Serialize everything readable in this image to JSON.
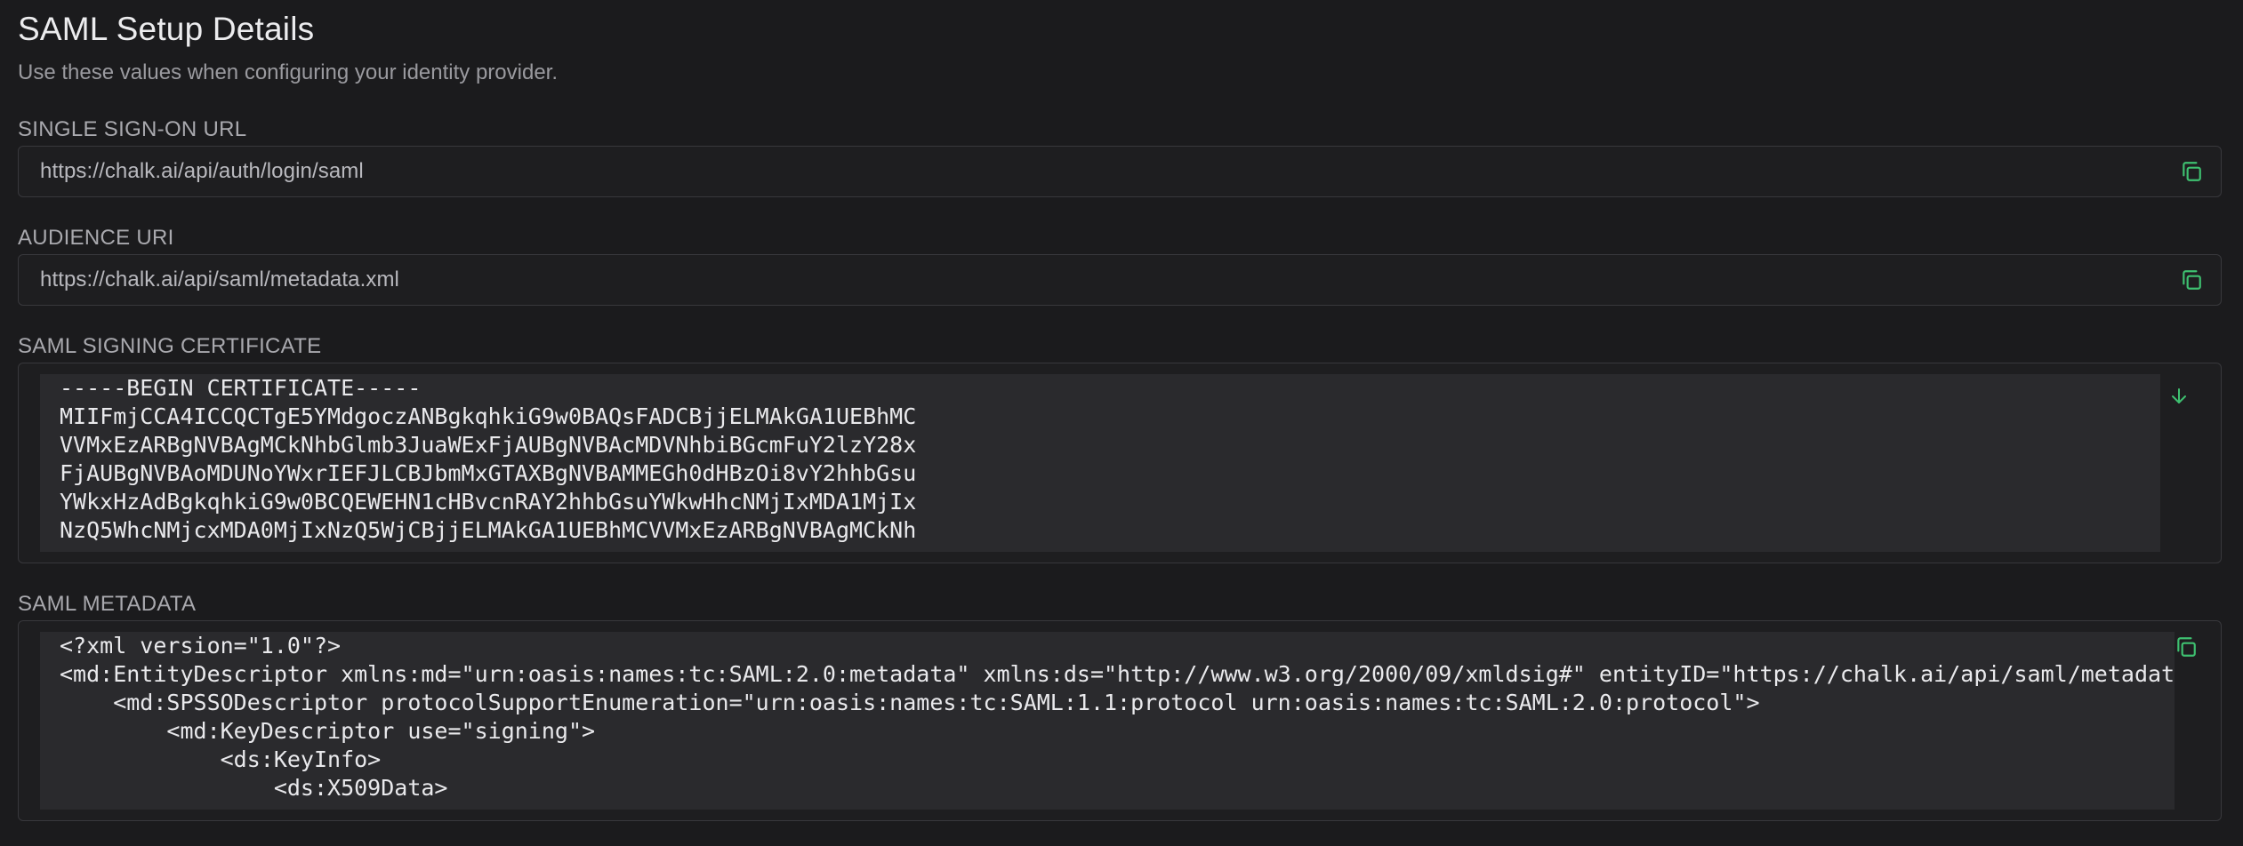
{
  "header": {
    "title": "SAML Setup Details",
    "subtitle": "Use these values when configuring your identity provider."
  },
  "sso": {
    "label": "SINGLE SIGN-ON URL",
    "value": "https://chalk.ai/api/auth/login/saml",
    "action_icon": "copy-icon"
  },
  "audience": {
    "label": "AUDIENCE URI",
    "value": "https://chalk.ai/api/saml/metadata.xml",
    "action_icon": "copy-icon"
  },
  "certificate": {
    "label": "SAML SIGNING CERTIFICATE",
    "action_icon": "download-icon",
    "content": "-----BEGIN CERTIFICATE-----\nMIIFmjCCA4ICCQCTgE5YMdgoczANBgkqhkiG9w0BAQsFADCBjjELMAkGA1UEBhMC\nVVMxEzARBgNVBAgMCkNhbGlmb3JuaWExFjAUBgNVBAcMDVNhbiBGcmFuY2lzY28x\nFjAUBgNVBAoMDUNoYWxrIEFJLCBJbmMxGTAXBgNVBAMMEGh0dHBzOi8vY2hhbGsu\nYWkxHzAdBgkqhkiG9w0BCQEWEHN1cHBvcnRAY2hhbGsuYWkwHhcNMjIxMDA1MjIx\nNzQ5WhcNMjcxMDA0MjIxNzQ5WjCBjjELMAkGA1UEBhMCVVMxEzARBgNVBAgMCkNh"
  },
  "metadata": {
    "label": "SAML METADATA",
    "action_icon": "copy-icon",
    "content": "<?xml version=\"1.0\"?>\n<md:EntityDescriptor xmlns:md=\"urn:oasis:names:tc:SAML:2.0:metadata\" xmlns:ds=\"http://www.w3.org/2000/09/xmldsig#\" entityID=\"https://chalk.ai/api/saml/metadata.xml\">\n    <md:SPSSODescriptor protocolSupportEnumeration=\"urn:oasis:names:tc:SAML:1.1:protocol urn:oasis:names:tc:SAML:2.0:protocol\">\n        <md:KeyDescriptor use=\"signing\">\n            <ds:KeyInfo>\n                <ds:X509Data>"
  },
  "colors": {
    "background": "#1b1b1d",
    "accent_icon": "#3ec070",
    "code_background": "#2a2a2d"
  }
}
